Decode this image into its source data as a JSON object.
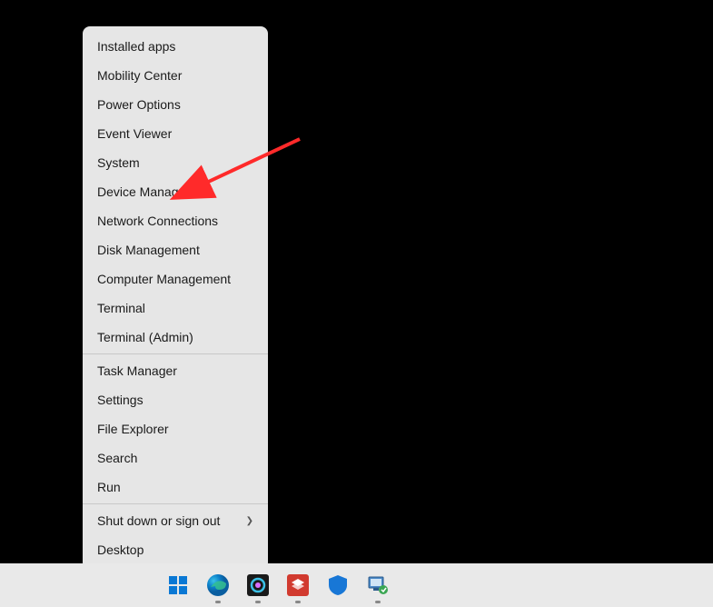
{
  "contextMenu": {
    "groups": [
      [
        {
          "label": "Installed apps",
          "name": "menu-installed-apps"
        },
        {
          "label": "Mobility Center",
          "name": "menu-mobility-center"
        },
        {
          "label": "Power Options",
          "name": "menu-power-options"
        },
        {
          "label": "Event Viewer",
          "name": "menu-event-viewer"
        },
        {
          "label": "System",
          "name": "menu-system"
        },
        {
          "label": "Device Manager",
          "name": "menu-device-manager"
        },
        {
          "label": "Network Connections",
          "name": "menu-network-connections"
        },
        {
          "label": "Disk Management",
          "name": "menu-disk-management"
        },
        {
          "label": "Computer Management",
          "name": "menu-computer-management"
        },
        {
          "label": "Terminal",
          "name": "menu-terminal"
        },
        {
          "label": "Terminal (Admin)",
          "name": "menu-terminal-admin"
        }
      ],
      [
        {
          "label": "Task Manager",
          "name": "menu-task-manager"
        },
        {
          "label": "Settings",
          "name": "menu-settings"
        },
        {
          "label": "File Explorer",
          "name": "menu-file-explorer"
        },
        {
          "label": "Search",
          "name": "menu-search"
        },
        {
          "label": "Run",
          "name": "menu-run"
        }
      ],
      [
        {
          "label": "Shut down or sign out",
          "name": "menu-shutdown",
          "submenu": true
        },
        {
          "label": "Desktop",
          "name": "menu-desktop"
        }
      ]
    ]
  },
  "taskbar": {
    "icons": [
      {
        "name": "start-icon",
        "running": false
      },
      {
        "name": "edge-icon",
        "running": true
      },
      {
        "name": "copilot-icon",
        "running": true
      },
      {
        "name": "app-red-icon",
        "running": true
      },
      {
        "name": "security-icon",
        "running": false
      },
      {
        "name": "system-tool-icon",
        "running": true
      }
    ]
  },
  "annotation": {
    "target": "menu-device-manager",
    "color": "#ff2a2a"
  }
}
